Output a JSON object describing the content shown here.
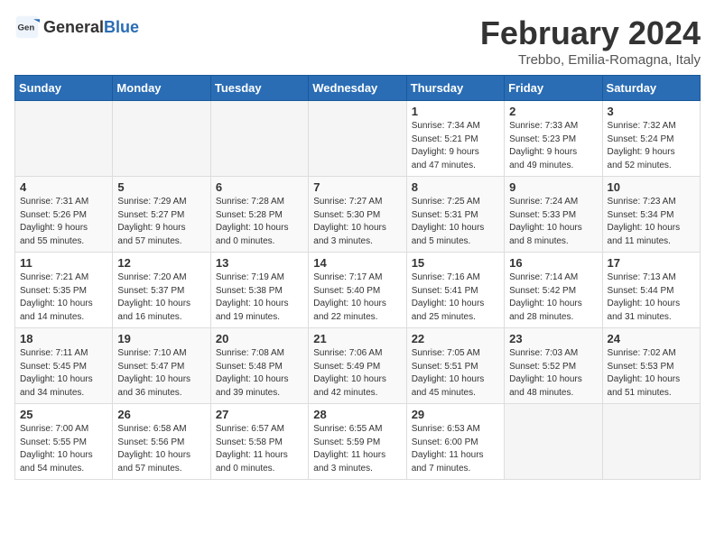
{
  "header": {
    "logo_general": "General",
    "logo_blue": "Blue",
    "title": "February 2024",
    "location": "Trebbo, Emilia-Romagna, Italy"
  },
  "weekdays": [
    "Sunday",
    "Monday",
    "Tuesday",
    "Wednesday",
    "Thursday",
    "Friday",
    "Saturday"
  ],
  "weeks": [
    [
      {
        "day": "",
        "content": ""
      },
      {
        "day": "",
        "content": ""
      },
      {
        "day": "",
        "content": ""
      },
      {
        "day": "",
        "content": ""
      },
      {
        "day": "1",
        "content": "Sunrise: 7:34 AM\nSunset: 5:21 PM\nDaylight: 9 hours\nand 47 minutes."
      },
      {
        "day": "2",
        "content": "Sunrise: 7:33 AM\nSunset: 5:23 PM\nDaylight: 9 hours\nand 49 minutes."
      },
      {
        "day": "3",
        "content": "Sunrise: 7:32 AM\nSunset: 5:24 PM\nDaylight: 9 hours\nand 52 minutes."
      }
    ],
    [
      {
        "day": "4",
        "content": "Sunrise: 7:31 AM\nSunset: 5:26 PM\nDaylight: 9 hours\nand 55 minutes."
      },
      {
        "day": "5",
        "content": "Sunrise: 7:29 AM\nSunset: 5:27 PM\nDaylight: 9 hours\nand 57 minutes."
      },
      {
        "day": "6",
        "content": "Sunrise: 7:28 AM\nSunset: 5:28 PM\nDaylight: 10 hours\nand 0 minutes."
      },
      {
        "day": "7",
        "content": "Sunrise: 7:27 AM\nSunset: 5:30 PM\nDaylight: 10 hours\nand 3 minutes."
      },
      {
        "day": "8",
        "content": "Sunrise: 7:25 AM\nSunset: 5:31 PM\nDaylight: 10 hours\nand 5 minutes."
      },
      {
        "day": "9",
        "content": "Sunrise: 7:24 AM\nSunset: 5:33 PM\nDaylight: 10 hours\nand 8 minutes."
      },
      {
        "day": "10",
        "content": "Sunrise: 7:23 AM\nSunset: 5:34 PM\nDaylight: 10 hours\nand 11 minutes."
      }
    ],
    [
      {
        "day": "11",
        "content": "Sunrise: 7:21 AM\nSunset: 5:35 PM\nDaylight: 10 hours\nand 14 minutes."
      },
      {
        "day": "12",
        "content": "Sunrise: 7:20 AM\nSunset: 5:37 PM\nDaylight: 10 hours\nand 16 minutes."
      },
      {
        "day": "13",
        "content": "Sunrise: 7:19 AM\nSunset: 5:38 PM\nDaylight: 10 hours\nand 19 minutes."
      },
      {
        "day": "14",
        "content": "Sunrise: 7:17 AM\nSunset: 5:40 PM\nDaylight: 10 hours\nand 22 minutes."
      },
      {
        "day": "15",
        "content": "Sunrise: 7:16 AM\nSunset: 5:41 PM\nDaylight: 10 hours\nand 25 minutes."
      },
      {
        "day": "16",
        "content": "Sunrise: 7:14 AM\nSunset: 5:42 PM\nDaylight: 10 hours\nand 28 minutes."
      },
      {
        "day": "17",
        "content": "Sunrise: 7:13 AM\nSunset: 5:44 PM\nDaylight: 10 hours\nand 31 minutes."
      }
    ],
    [
      {
        "day": "18",
        "content": "Sunrise: 7:11 AM\nSunset: 5:45 PM\nDaylight: 10 hours\nand 34 minutes."
      },
      {
        "day": "19",
        "content": "Sunrise: 7:10 AM\nSunset: 5:47 PM\nDaylight: 10 hours\nand 36 minutes."
      },
      {
        "day": "20",
        "content": "Sunrise: 7:08 AM\nSunset: 5:48 PM\nDaylight: 10 hours\nand 39 minutes."
      },
      {
        "day": "21",
        "content": "Sunrise: 7:06 AM\nSunset: 5:49 PM\nDaylight: 10 hours\nand 42 minutes."
      },
      {
        "day": "22",
        "content": "Sunrise: 7:05 AM\nSunset: 5:51 PM\nDaylight: 10 hours\nand 45 minutes."
      },
      {
        "day": "23",
        "content": "Sunrise: 7:03 AM\nSunset: 5:52 PM\nDaylight: 10 hours\nand 48 minutes."
      },
      {
        "day": "24",
        "content": "Sunrise: 7:02 AM\nSunset: 5:53 PM\nDaylight: 10 hours\nand 51 minutes."
      }
    ],
    [
      {
        "day": "25",
        "content": "Sunrise: 7:00 AM\nSunset: 5:55 PM\nDaylight: 10 hours\nand 54 minutes."
      },
      {
        "day": "26",
        "content": "Sunrise: 6:58 AM\nSunset: 5:56 PM\nDaylight: 10 hours\nand 57 minutes."
      },
      {
        "day": "27",
        "content": "Sunrise: 6:57 AM\nSunset: 5:58 PM\nDaylight: 11 hours\nand 0 minutes."
      },
      {
        "day": "28",
        "content": "Sunrise: 6:55 AM\nSunset: 5:59 PM\nDaylight: 11 hours\nand 3 minutes."
      },
      {
        "day": "29",
        "content": "Sunrise: 6:53 AM\nSunset: 6:00 PM\nDaylight: 11 hours\nand 7 minutes."
      },
      {
        "day": "",
        "content": ""
      },
      {
        "day": "",
        "content": ""
      }
    ]
  ]
}
